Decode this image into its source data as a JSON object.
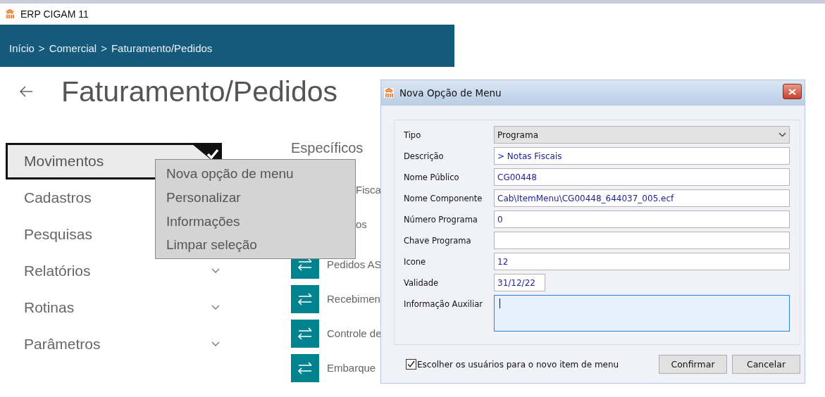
{
  "window": {
    "title": "ERP CIGAM 11"
  },
  "breadcrumb": [
    {
      "label": "Início"
    },
    {
      "label": "Comercial"
    },
    {
      "label": "Faturamento/Pedidos"
    }
  ],
  "breadcrumb_separator": ">",
  "page_title": "Faturamento/Pedidos",
  "nav": [
    {
      "label": "Movimentos",
      "selected": true,
      "chevron": false
    },
    {
      "label": "Cadastros",
      "selected": false,
      "chevron": false
    },
    {
      "label": "Pesquisas",
      "selected": false,
      "chevron": false
    },
    {
      "label": "Relatórios",
      "selected": false,
      "chevron": true
    },
    {
      "label": "Rotinas",
      "selected": false,
      "chevron": true
    },
    {
      "label": "Parâmetros",
      "selected": false,
      "chevron": true
    }
  ],
  "section": {
    "title": "Específicos",
    "items": [
      {
        "kind": "text",
        "label": "Fisca"
      },
      {
        "kind": "text",
        "label": "os"
      },
      {
        "kind": "tile",
        "label": "Pedidos AS"
      },
      {
        "kind": "tile",
        "label": "Recebimen"
      },
      {
        "kind": "tile",
        "label": "Controle de"
      },
      {
        "kind": "tile",
        "label": "Embarque"
      }
    ]
  },
  "context_menu": {
    "items": [
      {
        "label": "Nova opção de menu"
      },
      {
        "label": "Personalizar"
      },
      {
        "label": "Informações"
      },
      {
        "label": "Limpar seleção"
      }
    ]
  },
  "dialog": {
    "title": "Nova Opção de Menu",
    "fields": [
      {
        "kind": "select",
        "label": "Tipo",
        "value": "Programa"
      },
      {
        "kind": "text",
        "label": "Descrição",
        "value": "> Notas Fiscais"
      },
      {
        "kind": "text",
        "label": "Nome Público",
        "value": "CG00448"
      },
      {
        "kind": "text",
        "label": "Nome Componente",
        "value": "Cab\\ItemMenu\\CG00448_644037_005.ecf"
      },
      {
        "kind": "text",
        "label": "Número Programa",
        "value": "0"
      },
      {
        "kind": "text",
        "label": "Chave Programa"
      },
      {
        "kind": "text",
        "label": "Icone",
        "value": "12"
      },
      {
        "kind": "short",
        "label": "Validade",
        "value": "31/12/22"
      },
      {
        "kind": "memo",
        "label": "Informação Auxiliar",
        "focused": true
      }
    ],
    "checkbox": {
      "label": "Escolher os usuários para o novo item de menu",
      "checked": true
    },
    "buttons": [
      {
        "label": "Confirmar"
      },
      {
        "label": "Cancelar"
      }
    ]
  }
}
